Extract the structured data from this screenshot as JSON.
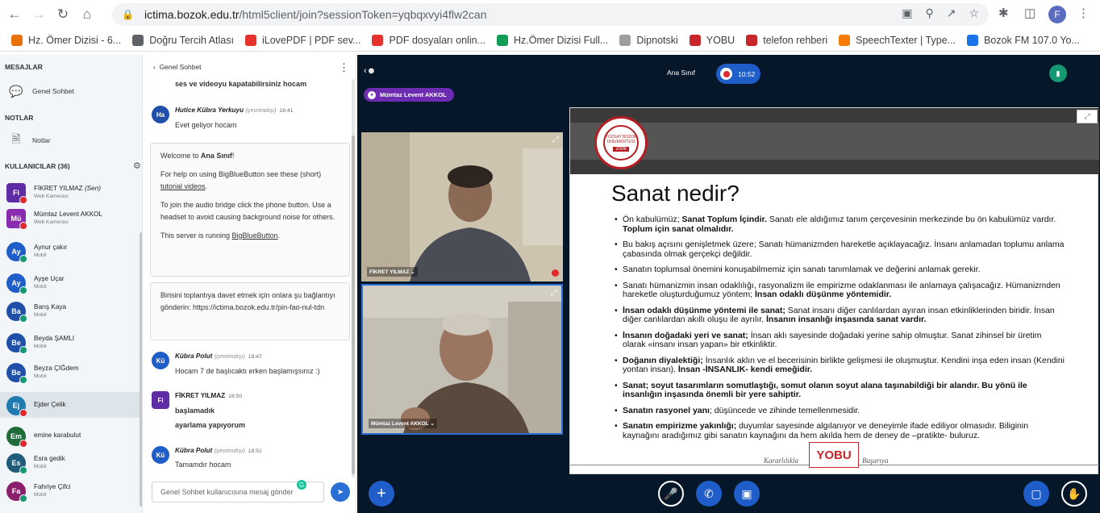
{
  "browser": {
    "url_host": "ictima.bozok.edu.tr",
    "url_path": "/html5client/join?sessionToken=yqbqxvyi4flw2can",
    "profile_initial": "F",
    "bookmarks": [
      {
        "label": "Hz. Ömer Dizisi - 6...",
        "color": "#e8710a"
      },
      {
        "label": "Doğru Tercih Atlası",
        "color": "#5f6368"
      },
      {
        "label": "iLovePDF | PDF sev...",
        "color": "#e5322d"
      },
      {
        "label": "PDF dosyaları onlin...",
        "color": "#e5322d"
      },
      {
        "label": "Hz.Ömer Dizisi Full...",
        "color": "#0f9d58"
      },
      {
        "label": "Dipnotski",
        "color": "#9e9e9e"
      },
      {
        "label": "YOBU",
        "color": "#c9262b"
      },
      {
        "label": "telefon rehberi",
        "color": "#c9262b"
      },
      {
        "label": "SpeechTexter | Type...",
        "color": "#f57c00"
      },
      {
        "label": "Bozok FM 107.0 Yo...",
        "color": "#1a73e8"
      }
    ]
  },
  "sidebar": {
    "messages_title": "MESAJLAR",
    "public_chat": "Genel Sohbet",
    "notes_title": "NOTLAR",
    "notes": "Notlar",
    "users_title": "KULLANICILAR (36)",
    "users": [
      {
        "initials": "Fi",
        "name": "FİKRET YILMAZ",
        "you": "(Sen)",
        "sub": "Web Kamerası",
        "color": "#5e2ca5",
        "square": true,
        "badge": "#e0282e"
      },
      {
        "initials": "Mü",
        "name": "Mümtaz Levent AKKOL",
        "you": "",
        "sub": "Web Kamerası",
        "color": "#8a2cb0",
        "square": true,
        "badge": "#e0282e"
      },
      {
        "initials": "Ay",
        "name": "Aynur çakır",
        "you": "",
        "sub": "Mobil",
        "color": "#1f5dc9",
        "square": false,
        "badge": "#159973"
      },
      {
        "initials": "Ay",
        "name": "Ayşe Uçar",
        "you": "",
        "sub": "Mobil",
        "color": "#1f5dc9",
        "square": false,
        "badge": "#159973"
      },
      {
        "initials": "Ba",
        "name": "Barış Kaya",
        "you": "",
        "sub": "Mobil",
        "color": "#1f4fa8",
        "square": false,
        "badge": "#159973"
      },
      {
        "initials": "Be",
        "name": "Beyda ŞAMLI",
        "you": "",
        "sub": "Mobil",
        "color": "#1f4fa8",
        "square": false,
        "badge": "#159973"
      },
      {
        "initials": "Be",
        "name": "Beyza ÇİĞdem",
        "you": "",
        "sub": "Mobil",
        "color": "#1f4fa8",
        "square": false,
        "badge": "#159973"
      },
      {
        "initials": "Ej",
        "name": "Ejder Çelik",
        "you": "",
        "sub": "",
        "color": "#1f7ab0",
        "square": false,
        "badge": "#e0282e"
      },
      {
        "initials": "Em",
        "name": "emine karabulut",
        "you": "",
        "sub": "",
        "color": "#1f6b3a",
        "square": false,
        "badge": "#e0282e"
      },
      {
        "initials": "Es",
        "name": "Esra gedik",
        "you": "",
        "sub": "Mobil",
        "color": "#1f5d7a",
        "square": false,
        "badge": "#159973"
      },
      {
        "initials": "Fa",
        "name": "Fahriye Çifci",
        "you": "",
        "sub": "Mobil",
        "color": "#8a1f6b",
        "square": false,
        "badge": "#159973"
      }
    ]
  },
  "chat": {
    "header": "Genel Sohbet",
    "partial_top": "ses ve videoyu kapatabilirsiniz hocam",
    "msg1": {
      "initials": "Ha",
      "name": "Hutice Kübra Yerkuyu",
      "status": "(çevrimdışı)",
      "time": "18:41",
      "text": "Evet geliyor hocam"
    },
    "welcome": {
      "l1a": "Welcome to ",
      "l1b": "Ana Sınıf",
      "l1c": "!",
      "l2": "For help on using BigBlueButton see these (short)",
      "l2link": "tutorial videos",
      "l3": "To join the audio bridge click the phone button. Use a headset to avoid causing background noise for others.",
      "l4a": "This server is running ",
      "l4b": "BigBlueButton",
      "l4c": "."
    },
    "invite": "Birisini toplantıya davet etmek için onlara şu bağlantıyı gönderin: https://ictima.bozok.edu.tr/pin-fao-nul-tdn",
    "msg2": {
      "initials": "Kü",
      "name": "Kübra Polut",
      "status": "(çevrimdışı)",
      "time": "18:47",
      "text": "Hocam 7 de başlıcaktı erken başlamışsınız :)"
    },
    "msg3": {
      "initials": "Fi",
      "name": "FİKRET YILMAZ",
      "time": "18:50",
      "text1": "başlamadık",
      "text2": "ayarlama yapıyorum"
    },
    "msg4": {
      "initials": "Kü",
      "name": "Kübra Polut",
      "status": "(çevrimdışı)",
      "time": "18:51",
      "text": "Tamamdır hocam"
    },
    "placeholder": "Genel Sohbet kullanıcısına mesaj gönder"
  },
  "main": {
    "room": "Ana Sınıf",
    "rec_time": "10:52",
    "talker": "Mümtaz Levent AKKOL",
    "video1_label": "FİKRET YILMAZ",
    "video2_label": "Mümtaz Levent AKKOL",
    "slide": {
      "title": "Sanat nedir?",
      "logo_text": "YOZGAT BOZOK ÜNİVERSİTESİ",
      "logo_year": "2006",
      "foot_left": "Kararlılıkla",
      "foot_right": "Başarıya",
      "foot_logo": "YOBU",
      "b1": [
        "Ön kabulümüz; ",
        "Sanat Toplum İçindir.",
        " Sanatı ele aldığımız tanım çerçevesinin merkezinde bu ön kabulümüz vardır. ",
        "Toplum için sanat olmalıdır."
      ],
      "b2": "Bu bakış açısını genişletmek üzere; Sanatı hümanizmden hareketle açıklayacağız. İnsanı anlamadan toplumu anlama çabasında olmak gerçekçi değildir.",
      "b3": "Sanatın toplumsal önemini konuşabilmemiz için sanatı tanımlamak ve değerini anlamak gerekir.",
      "b4": [
        "Sanatı hümanizmin insan odaklılığı, rasyonalizm ile empirizme odaklanması ile anlamaya çalışacağız. Hümanizmden hareketle oluşturduğumuz yöntem; ",
        "İnsan odaklı düşünme yöntemidir."
      ],
      "b5": [
        "İnsan odaklı düşünme yöntemi ile sanat;",
        " Sanat insanı diğer canlılardan ayıran insan etkinliklerinden biridir. İnsan diğer canlılardan akıllı oluşu ile ayrılır. ",
        "İnsanın insanlığı inşasında sanat vardır."
      ],
      "b6": [
        "İnsanın doğadaki yeri ve sanat;",
        " İnsan aklı sayesinde doğadaki yerine sahip olmuştur. Sanat zihinsel bir üretim olarak «insanı insan yapan» bir etkinliktir."
      ],
      "b7": [
        "Doğanın diyalektiği;",
        " İnsanlık aklın ve el becerisinin birlikte gelişmesi ile oluşmuştur. Kendini inşa eden insan (Kendini yontan insan). ",
        "İnsan  -İNSANLIK- kendi emeğidir."
      ],
      "b8": "Sanat; soyut tasarımların somutlaştığı, somut olanın soyut alana taşınabildiği bir alandır. Bu yönü ile insanlığın inşasında önemli bir yere sahiptir.",
      "b9": [
        "Sanatın rasyonel yanı",
        "; düşüncede ve zihinde temellenmesidir."
      ],
      "b10": [
        "Sanatın empirizme yakınlığı;",
        " duyumlar sayesinde algılanıyor ve deneyimle ifade ediliyor olmasıdır. Biliginin kaynağını aradığımız gibi sanatın kaynağını  da hem akılda hem de deney de –pratikte- buluruz."
      ]
    }
  }
}
